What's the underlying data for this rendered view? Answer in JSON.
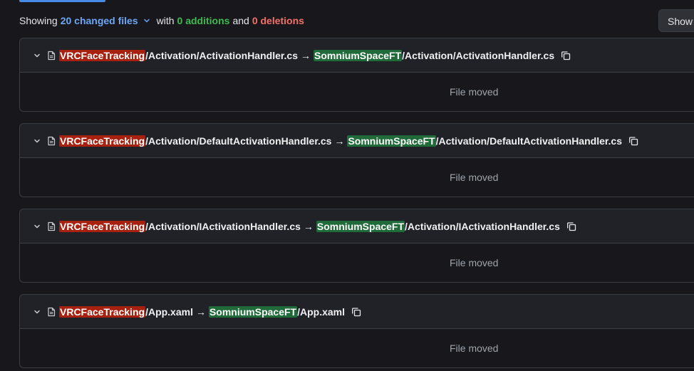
{
  "summary": {
    "showing": "Showing",
    "changed_files": "20 changed files",
    "with": "with",
    "additions": "0 additions",
    "and": "and",
    "deletions": "0 deletions"
  },
  "toolbar": {
    "show_label": "Show"
  },
  "files": [
    {
      "old_root": "VRCFaceTracking",
      "old_rest": "/Activation/ActivationHandler.cs",
      "arrow": "→",
      "new_root": "SomniumSpaceFT",
      "new_rest": "/Activation/ActivationHandler.cs",
      "status": "File moved"
    },
    {
      "old_root": "VRCFaceTracking",
      "old_rest": "/Activation/DefaultActivationHandler.cs",
      "arrow": "→",
      "new_root": "SomniumSpaceFT",
      "new_rest": "/Activation/DefaultActivationHandler.cs",
      "status": "File moved"
    },
    {
      "old_root": "VRCFaceTracking",
      "old_rest": "/Activation/IActivationHandler.cs",
      "arrow": "→",
      "new_root": "SomniumSpaceFT",
      "new_rest": "/Activation/IActivationHandler.cs",
      "status": "File moved"
    },
    {
      "old_root": "VRCFaceTracking",
      "old_rest": "/App.xaml",
      "arrow": "→",
      "new_root": "SomniumSpaceFT",
      "new_rest": "/App.xaml",
      "status": "File moved"
    }
  ],
  "icons": {
    "toggle": "chevron-down-icon",
    "file": "file-icon",
    "copy": "copy-icon",
    "dropdown": "chevron-down-icon"
  },
  "colors": {
    "accent": "#6ca6f5",
    "additions": "#3fb950",
    "deletions": "#f47067",
    "old_path_highlight": "#a8210f",
    "new_path_highlight": "#1f6b3a"
  }
}
